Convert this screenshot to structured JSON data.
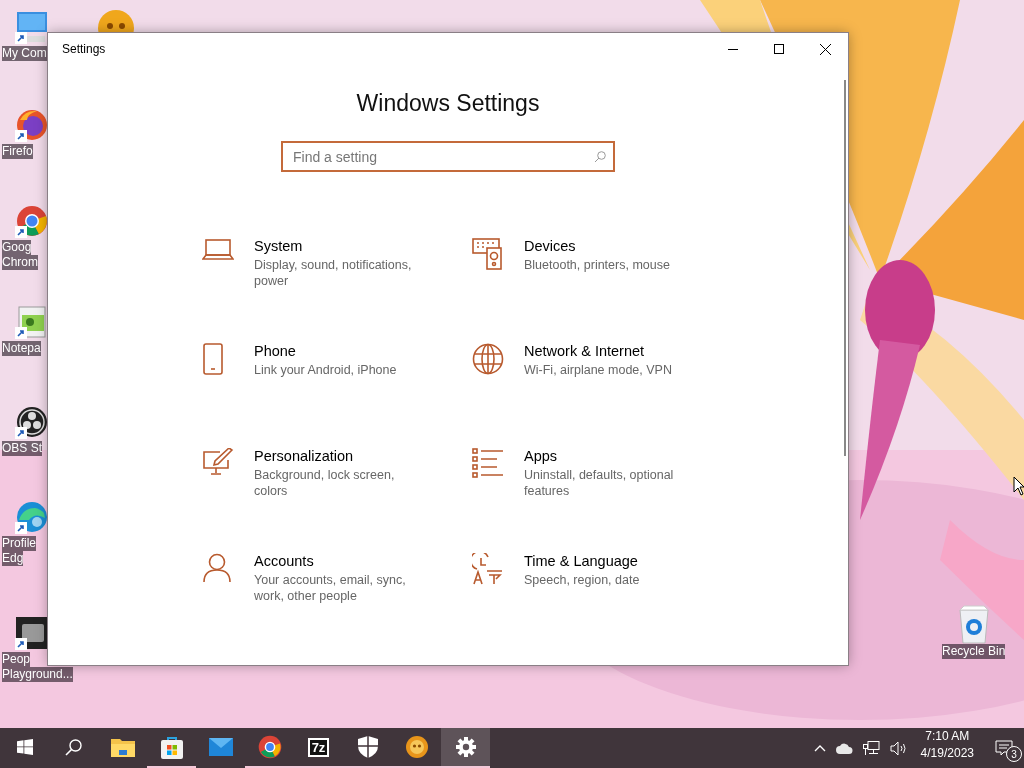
{
  "desktop": {
    "icons": [
      {
        "kind": "computer",
        "label": [
          "My Com"
        ]
      },
      {
        "kind": "firefox",
        "label": [
          "Firefo"
        ]
      },
      {
        "kind": "chrome",
        "label": [
          "Goog",
          "Chrom"
        ]
      },
      {
        "kind": "notepad",
        "label": [
          "Notepa"
        ]
      },
      {
        "kind": "obs",
        "label": [
          "OBS St"
        ]
      },
      {
        "kind": "edge",
        "label": [
          "Profile",
          "Edg"
        ]
      },
      {
        "kind": "app",
        "label": [
          "Peop",
          "Playground..."
        ]
      }
    ],
    "recycle_bin": {
      "label": "Recycle Bin"
    }
  },
  "window": {
    "title": "Settings",
    "heading": "Windows Settings",
    "search": {
      "placeholder": "Find a setting"
    },
    "categories": [
      {
        "kind": "system",
        "name": "System",
        "description": "Display, sound, notifications, power"
      },
      {
        "kind": "devices",
        "name": "Devices",
        "description": "Bluetooth, printers, mouse"
      },
      {
        "kind": "phone",
        "name": "Phone",
        "description": "Link your Android, iPhone"
      },
      {
        "kind": "network",
        "name": "Network & Internet",
        "description": "Wi-Fi, airplane mode, VPN"
      },
      {
        "kind": "personalization",
        "name": "Personalization",
        "description": "Background, lock screen, colors"
      },
      {
        "kind": "apps",
        "name": "Apps",
        "description": "Uninstall, defaults, optional features"
      },
      {
        "kind": "accounts",
        "name": "Accounts",
        "description": "Your accounts, email, sync, work, other people"
      },
      {
        "kind": "time",
        "name": "Time & Language",
        "description": "Speech, region, date"
      }
    ]
  },
  "taskbar": {
    "items": [
      {
        "kind": "start",
        "running": false,
        "selected": false
      },
      {
        "kind": "search",
        "running": false,
        "selected": false
      },
      {
        "kind": "explorer",
        "running": false,
        "selected": false
      },
      {
        "kind": "store",
        "running": true,
        "selected": false
      },
      {
        "kind": "mail",
        "running": false,
        "selected": false
      },
      {
        "kind": "chrome",
        "running": true,
        "selected": false
      },
      {
        "kind": "sevenzip",
        "label": "7z",
        "running": true,
        "selected": false
      },
      {
        "kind": "shield",
        "running": true,
        "selected": false
      },
      {
        "kind": "skull",
        "running": true,
        "selected": false
      },
      {
        "kind": "settings",
        "running": true,
        "selected": true
      }
    ],
    "tray": {
      "time": "7:10 AM",
      "date": "4/19/2023",
      "notifications": "3"
    }
  }
}
